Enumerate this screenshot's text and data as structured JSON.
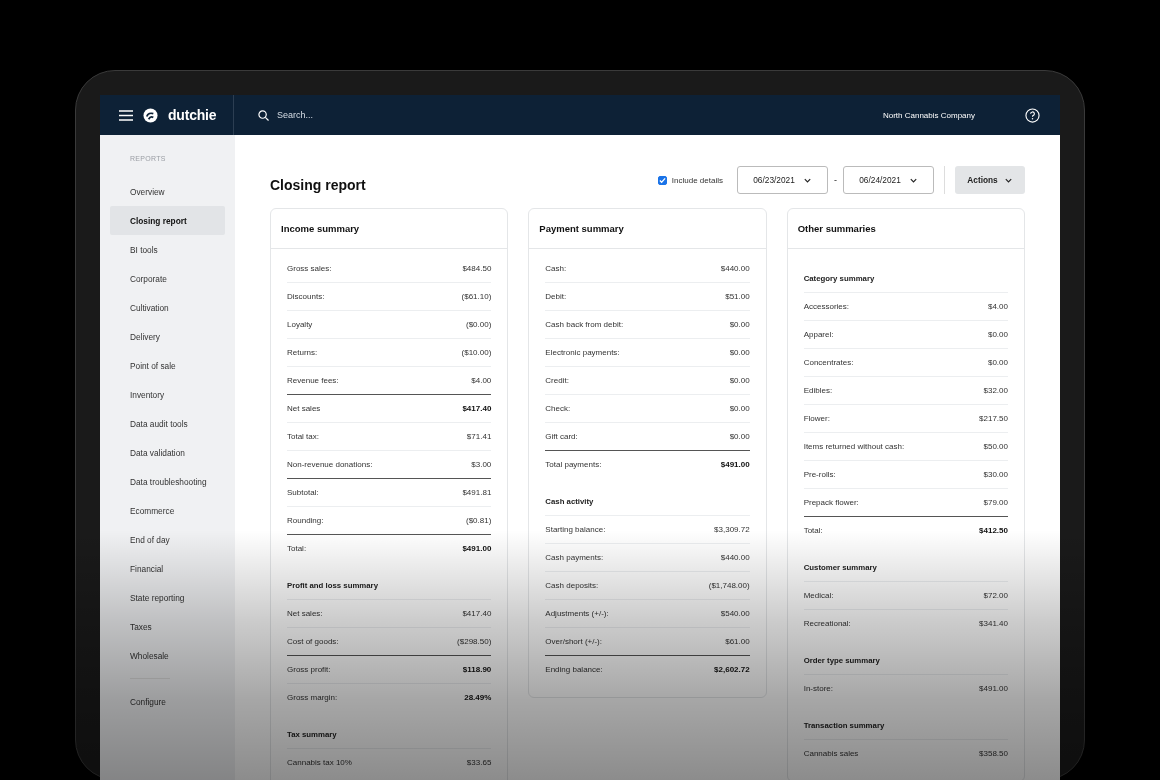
{
  "topbar": {
    "brand": "dutchie",
    "search_placeholder": "Search...",
    "company": "North Cannabis Company"
  },
  "sidebar": {
    "heading": "REPORTS",
    "items": [
      {
        "label": "Overview",
        "selected": false
      },
      {
        "label": "Closing report",
        "selected": true
      },
      {
        "label": "BI tools",
        "selected": false
      },
      {
        "label": "Corporate",
        "selected": false
      },
      {
        "label": "Cultivation",
        "selected": false
      },
      {
        "label": "Delivery",
        "selected": false
      },
      {
        "label": "Point of sale",
        "selected": false
      },
      {
        "label": "Inventory",
        "selected": false
      },
      {
        "label": "Data audit tools",
        "selected": false
      },
      {
        "label": "Data validation",
        "selected": false
      },
      {
        "label": "Data troubleshooting",
        "selected": false
      },
      {
        "label": "Ecommerce",
        "selected": false
      },
      {
        "label": "End of day",
        "selected": false
      },
      {
        "label": "Financial",
        "selected": false
      },
      {
        "label": "State reporting",
        "selected": false
      },
      {
        "label": "Taxes",
        "selected": false
      },
      {
        "label": "Wholesale",
        "selected": false
      }
    ],
    "footer_item": "Configure"
  },
  "page": {
    "title": "Closing report",
    "include_details": {
      "label": "Include details",
      "checked": true
    },
    "date_from": "06/23/2021",
    "date_to": "06/24/2021",
    "separator": "-",
    "actions": "Actions"
  },
  "cards": [
    {
      "title": "Income summary",
      "sections": [
        {
          "rows": [
            {
              "label": "Gross sales:",
              "value": "$484.50",
              "kind": "item"
            },
            {
              "label": "Discounts:",
              "value": "($61.10)",
              "kind": "item"
            },
            {
              "label": "Loyalty",
              "value": "($0.00)",
              "kind": "item"
            },
            {
              "label": "Returns:",
              "value": "($10.00)",
              "kind": "item"
            },
            {
              "label": "Revenue fees:",
              "value": "$4.00",
              "kind": "item"
            },
            {
              "label": "Net sales",
              "value": "$417.40",
              "kind": "total"
            },
            {
              "label": "Total tax:",
              "value": "$71.41",
              "kind": "item"
            },
            {
              "label": "Non-revenue donations:",
              "value": "$3.00",
              "kind": "item"
            },
            {
              "label": "Subtotal:",
              "value": "$491.81",
              "kind": "ruled"
            },
            {
              "label": "Rounding:",
              "value": "($0.81)",
              "kind": "item"
            },
            {
              "label": "Total:",
              "value": "$491.00",
              "kind": "total"
            }
          ]
        },
        {
          "heading": "Profit and loss summary",
          "rows": [
            {
              "label": "Net sales:",
              "value": "$417.40",
              "kind": "item"
            },
            {
              "label": "Cost of goods:",
              "value": "($298.50)",
              "kind": "item"
            },
            {
              "label": "Gross profit:",
              "value": "$118.90",
              "kind": "total"
            },
            {
              "label": "Gross margin:",
              "value": "28.49%",
              "kind": "bold"
            }
          ]
        },
        {
          "heading": "Tax summary",
          "rows": [
            {
              "label": "Cannabis tax 10%",
              "value": "$33.65",
              "kind": "item"
            }
          ]
        }
      ]
    },
    {
      "title": "Payment summary",
      "sections": [
        {
          "rows": [
            {
              "label": "Cash:",
              "value": "$440.00",
              "kind": "item"
            },
            {
              "label": "Debit:",
              "value": "$51.00",
              "kind": "item"
            },
            {
              "label": "Cash back from debit:",
              "value": "$0.00",
              "kind": "item"
            },
            {
              "label": "Electronic payments:",
              "value": "$0.00",
              "kind": "item"
            },
            {
              "label": "Credit:",
              "value": "$0.00",
              "kind": "item"
            },
            {
              "label": "Check:",
              "value": "$0.00",
              "kind": "item"
            },
            {
              "label": "Gift card:",
              "value": "$0.00",
              "kind": "item"
            },
            {
              "label": "Total payments:",
              "value": "$491.00",
              "kind": "total"
            }
          ]
        },
        {
          "heading": "Cash activity",
          "rows": [
            {
              "label": "Starting balance:",
              "value": "$3,309.72",
              "kind": "item"
            },
            {
              "label": "Cash payments:",
              "value": "$440.00",
              "kind": "item"
            },
            {
              "label": "Cash deposits:",
              "value": "($1,748.00)",
              "kind": "item"
            },
            {
              "label": "Adjustments (+/-):",
              "value": "$540.00",
              "kind": "item"
            },
            {
              "label": "Over/short (+/-):",
              "value": "$61.00",
              "kind": "item"
            },
            {
              "label": "Ending balance:",
              "value": "$2,602.72",
              "kind": "total"
            }
          ]
        }
      ]
    },
    {
      "title": "Other summaries",
      "sections": [
        {
          "heading": "Category summary",
          "rows": [
            {
              "label": "Accessories:",
              "value": "$4.00",
              "kind": "item"
            },
            {
              "label": "Apparel:",
              "value": "$0.00",
              "kind": "item"
            },
            {
              "label": "Concentrates:",
              "value": "$0.00",
              "kind": "item"
            },
            {
              "label": "Edibles:",
              "value": "$32.00",
              "kind": "item"
            },
            {
              "label": "Flower:",
              "value": "$217.50",
              "kind": "item"
            },
            {
              "label": "Items returned without cash:",
              "value": "$50.00",
              "kind": "item"
            },
            {
              "label": "Pre-rolls:",
              "value": "$30.00",
              "kind": "item"
            },
            {
              "label": "Prepack flower:",
              "value": "$79.00",
              "kind": "item"
            },
            {
              "label": "Total:",
              "value": "$412.50",
              "kind": "total"
            }
          ]
        },
        {
          "heading": "Customer summary",
          "rows": [
            {
              "label": "Medical:",
              "value": "$72.00",
              "kind": "item"
            },
            {
              "label": "Recreational:",
              "value": "$341.40",
              "kind": "item"
            }
          ]
        },
        {
          "heading": "Order type summary",
          "rows": [
            {
              "label": "In-store:",
              "value": "$491.00",
              "kind": "item"
            }
          ]
        },
        {
          "heading": "Transaction summary",
          "rows": [
            {
              "label": "Cannabis sales",
              "value": "$358.50",
              "kind": "item"
            }
          ]
        }
      ]
    }
  ]
}
